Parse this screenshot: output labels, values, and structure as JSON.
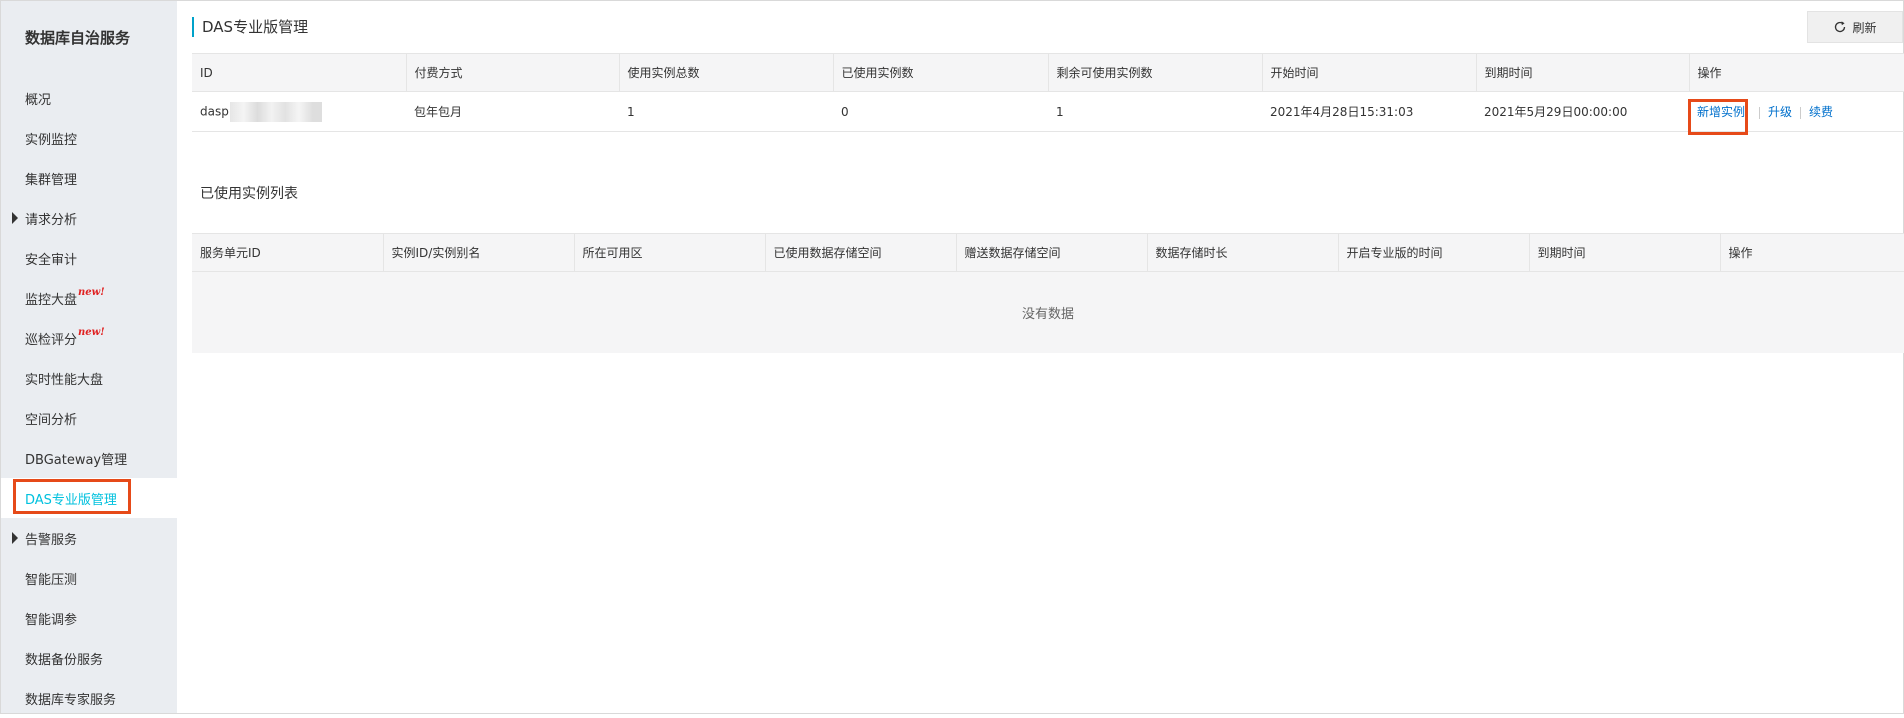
{
  "sidebar": {
    "title": "数据库自治服务",
    "items": [
      {
        "label": "概况"
      },
      {
        "label": "实例监控"
      },
      {
        "label": "集群管理"
      },
      {
        "label": "请求分析",
        "expandable": true
      },
      {
        "label": "安全审计"
      },
      {
        "label": "监控大盘",
        "badge": "new!"
      },
      {
        "label": "巡检评分",
        "badge": "new!"
      },
      {
        "label": "实时性能大盘"
      },
      {
        "label": "空间分析"
      },
      {
        "label": "DBGateway管理"
      },
      {
        "label": "DAS专业版管理",
        "active": true
      },
      {
        "label": "告警服务",
        "expandable": true
      },
      {
        "label": "智能压测"
      },
      {
        "label": "智能调参"
      },
      {
        "label": "数据备份服务"
      },
      {
        "label": "数据库专家服务"
      }
    ]
  },
  "header": {
    "title": "DAS专业版管理",
    "refresh_label": "刷新"
  },
  "summary_table": {
    "columns": [
      "ID",
      "付费方式",
      "使用实例总数",
      "已使用实例数",
      "剩余可使用实例数",
      "开始时间",
      "到期时间",
      "操作"
    ],
    "rows": [
      {
        "id": "daspi",
        "payment": "包年包月",
        "total": "1",
        "used": "0",
        "remaining": "1",
        "start": "2021年4月28日15:31:03",
        "expire": "2021年5月29日00:00:00",
        "actions": {
          "add": "新增实例",
          "upgrade": "升级",
          "renew": "续费"
        }
      }
    ]
  },
  "used_section": {
    "title": "已使用实例列表",
    "columns": [
      "服务单元ID",
      "实例ID/实例别名",
      "所在可用区",
      "已使用数据存储空间",
      "赠送数据存储空间",
      "数据存储时长",
      "开启专业版的时间",
      "到期时间",
      "操作"
    ],
    "empty_text": "没有数据"
  },
  "colors": {
    "accent": "#00c1de",
    "link": "#0070cc",
    "highlight": "#e64a19",
    "sidebar_bg": "#eaedf1"
  }
}
